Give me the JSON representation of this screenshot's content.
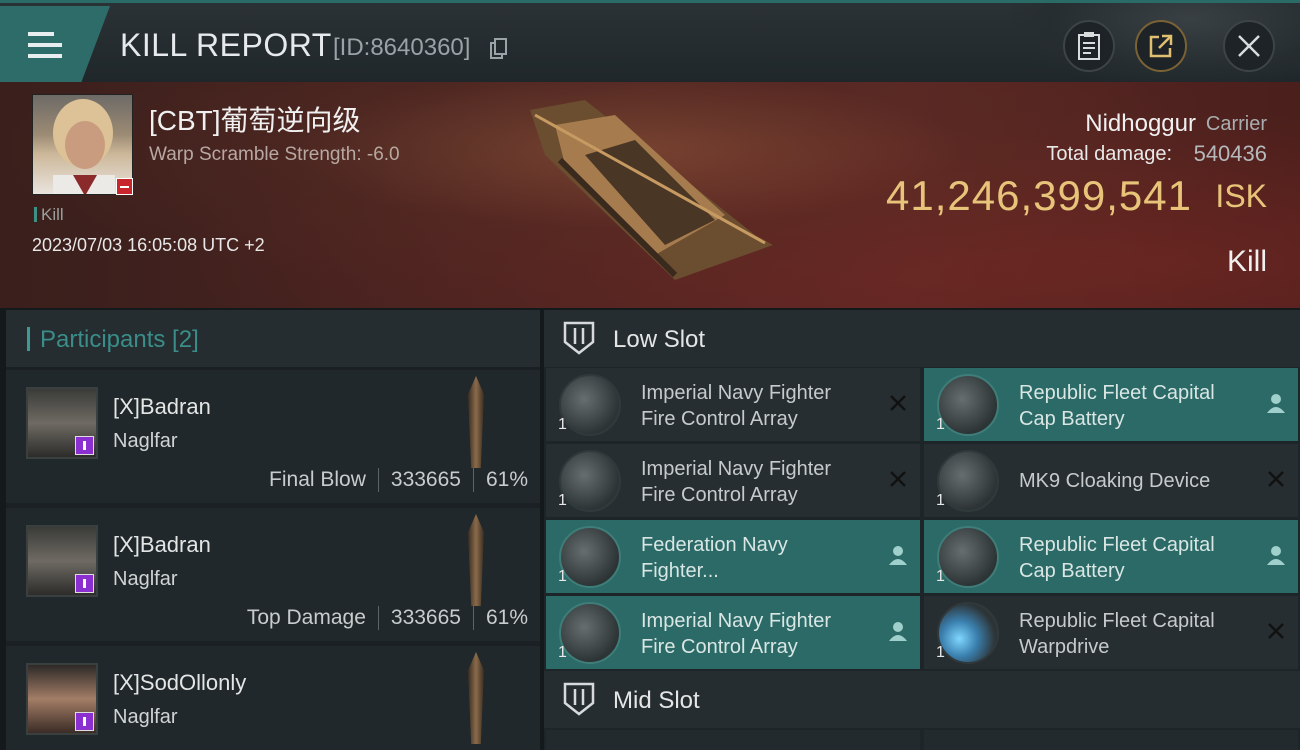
{
  "header": {
    "title": "KILL REPORT",
    "report_id": "[ID:8640360]"
  },
  "victim": {
    "name": "[CBT]葡萄逆向级",
    "warp_strength": "Warp Scramble Strength: -6.0",
    "kill_tag": "Kill",
    "date": "2023/07/03 16:05:08 UTC +2",
    "ship_name": "Nidhoggur",
    "ship_class": "Carrier",
    "damage_label": "Total damage:",
    "damage_value": "540436",
    "isk_value": "41,246,399,541",
    "isk_unit": "ISK",
    "status": "Kill"
  },
  "participants": {
    "title": "Participants [2]",
    "rows": [
      {
        "name": "[X]Badran",
        "ship": "Naglfar",
        "role": "Final Blow",
        "damage": "333665",
        "pct": "61%"
      },
      {
        "name": "[X]Badran",
        "ship": "Naglfar",
        "role": "Top Damage",
        "damage": "333665",
        "pct": "61%"
      },
      {
        "name": "[X]SodOllonly",
        "ship": "Naglfar"
      }
    ]
  },
  "low_slot": {
    "title": "Low Slot",
    "modules": [
      {
        "line1": "Imperial Navy Fighter",
        "line2": "Fire Control Array",
        "qty": "1",
        "state": "destroyed",
        "icon": "fighter-array-icon"
      },
      {
        "line1": "Republic Fleet Capital",
        "line2": "Cap Battery",
        "qty": "1",
        "state": "dropped",
        "icon": "cap-battery-icon"
      },
      {
        "line1": "Imperial Navy Fighter",
        "line2": "Fire Control Array",
        "qty": "1",
        "state": "destroyed",
        "icon": "fighter-array-icon"
      },
      {
        "line1": "MK9 Cloaking Device",
        "line2": "",
        "qty": "1",
        "state": "destroyed",
        "icon": "cloaking-device-icon"
      },
      {
        "line1": "Federation Navy",
        "line2": "Fighter...",
        "qty": "1",
        "state": "dropped",
        "icon": "fighter-support-icon"
      },
      {
        "line1": "Republic Fleet Capital",
        "line2": "Cap Battery",
        "qty": "1",
        "state": "dropped",
        "icon": "cap-battery-icon"
      },
      {
        "line1": "Imperial Navy Fighter",
        "line2": "Fire Control Array",
        "qty": "1",
        "state": "dropped",
        "icon": "fighter-array-icon"
      },
      {
        "line1": "Republic Fleet Capital",
        "line2": "Warpdrive",
        "qty": "1",
        "state": "destroyed",
        "icon": "warpdrive-icon"
      }
    ]
  },
  "mid_slot": {
    "title": "Mid Slot"
  },
  "colors": {
    "accent": "#2c6a67",
    "isk": "#e8c47a",
    "banner": "#4a2421"
  }
}
